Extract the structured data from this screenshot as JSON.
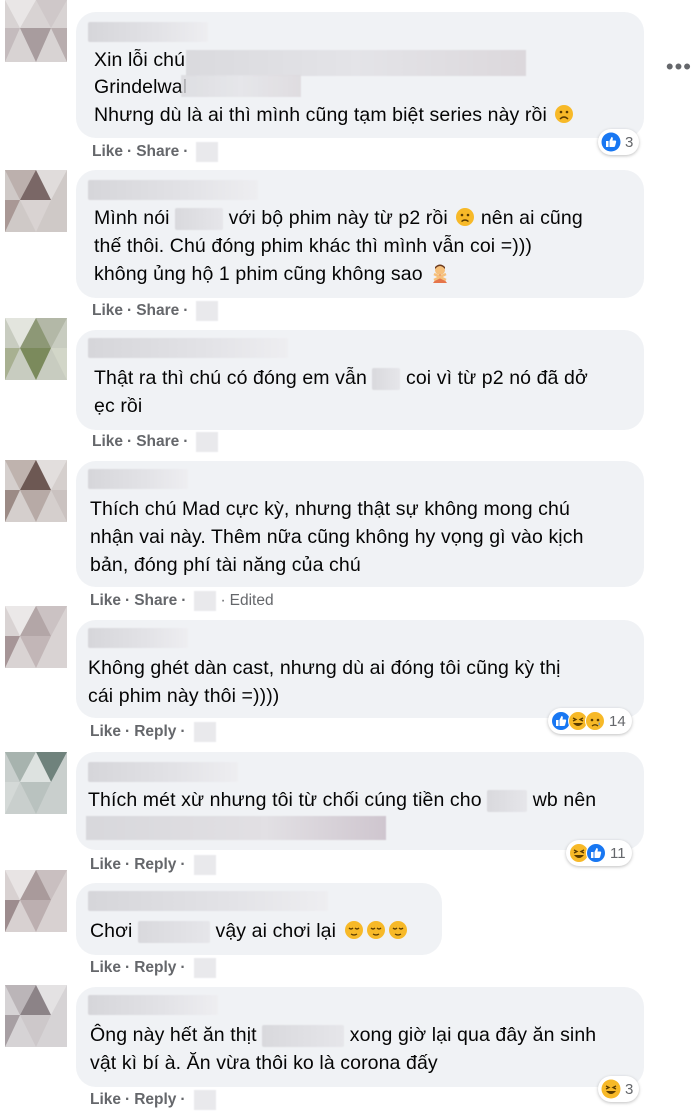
{
  "ui": {
    "like": "Like",
    "share": "Share",
    "reply": "Reply",
    "edited": "Edited",
    "more_icon": "more-horizontal-icon"
  },
  "comments": [
    {
      "lines": [
        "Xin lỗi chú",
        "Grindelwal",
        "Nhưng dù là ai thì mình cũng tạm biệt series này rồi"
      ],
      "second_action": "Share",
      "reaction_icons": [
        "like"
      ],
      "reaction_count": "3"
    },
    {
      "lines": [
        "Mình nói",
        "với bộ phim này từ p2 rồi",
        "nên ai cũng",
        "thế thôi. Chú đóng phim khác thì mình vẫn coi =)))",
        "không ủng hộ 1 phim cũng không sao"
      ],
      "second_action": "Share"
    },
    {
      "lines": [
        "Thật ra thì chú có đóng em vẫn",
        "coi vì từ p2 nó đã dở",
        "ẹc rồi"
      ],
      "second_action": "Share"
    },
    {
      "lines": [
        "Thích chú Mad cực kỳ, nhưng thật sự không mong chú",
        "nhận vai này. Thêm nữa cũng không hy vọng gì vào kịch",
        "bản, đóng phí tài năng của chú"
      ],
      "second_action": "Share",
      "edited": "Edited"
    },
    {
      "lines": [
        "Không ghét dàn cast, nhưng dù ai đóng tôi cũng kỳ thị",
        "cái phim này thôi =))))"
      ],
      "second_action": "Reply",
      "reaction_icons": [
        "like",
        "haha",
        "sad"
      ],
      "reaction_count": "14"
    },
    {
      "lines": [
        "Thích mét xừ nhưng tôi từ chối cúng tiền cho",
        "wb nên"
      ],
      "second_action": "Reply",
      "reaction_icons": [
        "haha",
        "like"
      ],
      "reaction_count": "11"
    },
    {
      "lines": [
        "Chơi",
        "vậy ai chơi lại"
      ],
      "second_action": "Reply"
    },
    {
      "lines": [
        "Ông này hết ăn thịt",
        "xong giờ lại qua đây ăn sinh",
        "vật kì bí à. Ăn vừa thôi ko là corona đấy"
      ],
      "second_action": "Reply",
      "reaction_icons": [
        "haha"
      ],
      "reaction_count": "3"
    }
  ],
  "colors": {
    "bubble": "#f0f2f5",
    "meta": "#65676b",
    "text": "#050505",
    "like_blue": "#1877f2",
    "emoji_yellow": "#f7b928"
  }
}
